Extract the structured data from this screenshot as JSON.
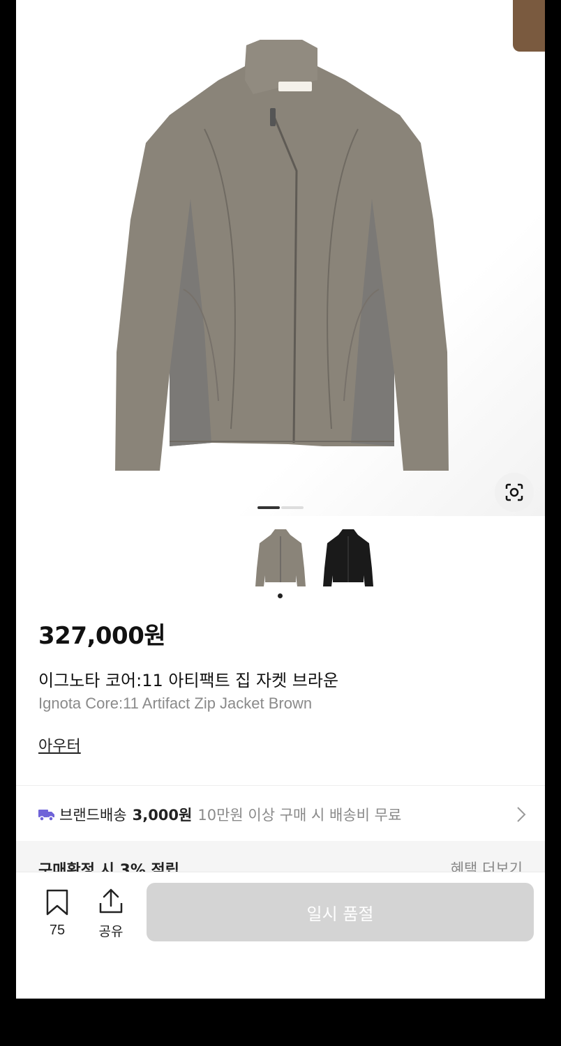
{
  "product": {
    "price": "327,000원",
    "name_ko": "이그노타 코어:11 아티팩트 집 자켓 브라운",
    "name_en": "Ignota Core:11 Artifact Zip Jacket Brown",
    "category": "아우터",
    "color_options": [
      "grey-brown",
      "black"
    ]
  },
  "shipping": {
    "brand_label": "브랜드배송",
    "cost": "3,000원",
    "note": "10만원 이상 구매 시 배송비 무료"
  },
  "benefit": {
    "text": "구매확정 시 3% 적립",
    "more_label": "혜택 더보기"
  },
  "bottom_bar": {
    "bookmark_count": "75",
    "share_label": "공유",
    "soldout_label": "일시 품절"
  },
  "colors": {
    "jacket_main": "#8a8479",
    "jacket_panel": "#7d7a76",
    "soldout_bg": "#d4d4d4",
    "ship_icon": "#6f63d8",
    "accent_corner": "#7a5a3f"
  }
}
